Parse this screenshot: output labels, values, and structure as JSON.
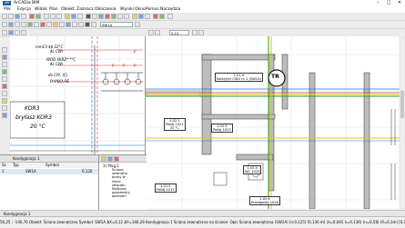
{
  "window": {
    "title": "ArCADia BIM",
    "app_icon": "AR",
    "minimize": "–",
    "maximize": "□",
    "close": "✕"
  },
  "menu": [
    "Plik",
    "Edycja",
    "Widok",
    "Plan",
    "Obiekt",
    "Zaznacz",
    "Oblicze­nia",
    "Wyniki",
    "Okno",
    "Pomoc",
    "Narzędzia",
    "Pomoc"
  ],
  "toolbar": {
    "layer_label": "SW1A",
    "zoom_value": "0,12"
  },
  "left_drawing": {
    "texts": [
      "mmCil $$ 22°C",
      "4L CWl",
      "WOD SKRZ* *°C",
      "4L CWl",
      "do Cfl/, (C)",
      "PIANKA PE",
      "KOR3",
      "bryłasz KOR3",
      "20 °C"
    ],
    "arrows": [
      "P",
      "P",
      "P",
      "P"
    ],
    "labels": [
      "KOR3",
      "KOR3"
    ]
  },
  "right_drawing": {
    "rooms": [
      {
        "num": "1.01.4",
        "name": "Kaloryfer CWU nr 1 (SW1A)",
        "area": "6,50"
      },
      {
        "num": "1.02.1",
        "name": "Pokój 1021",
        "area": "20 °C"
      },
      {
        "num": "1.02.3",
        "name": "Pokój 1023",
        "area": "20 °C"
      },
      {
        "num": "1.02.5",
        "name": "WC 1025",
        "area": "20 °C"
      },
      {
        "num": "1.02.6",
        "name": "Przedpokój 1026",
        "area": "20 °C"
      },
      {
        "num": "1.01.5",
        "name": "Pokój 1015",
        "area": ""
      }
    ],
    "tr_marker": "TR"
  },
  "panel_tabs": {
    "left": "Kondygnacja 1",
    "right": "Kondygnacja 1"
  },
  "bottom_left": {
    "header": [
      "Sz",
      "Typ",
      "Symbol"
    ],
    "rows": [
      [
        "1",
        "",
        "SW1A"
      ]
    ],
    "value": "0,120"
  },
  "table_panel": {
    "title": "1) Pług 1",
    "lines": [
      "Ściana",
      "zewnętrz",
      "piony w",
      "liście",
      "zespołu",
      "Wyboraj",
      "parametry",
      "obliczeń"
    ]
  },
  "status": "56,25 : -146,76   Obiekt: Ściana zewnętrzna   Symbol: SW1A   ΔX=0,12  ΔY=146,26   Kondygnacja 1   Ściana zewnętrzna na ścianie: Opis   Ściana zewnętrzna (SW1A) [n:0,125] [0,136 m] (λ=0,045 λ=0,136) (n=0,58) (δ=0,1m) [0,1m]"
}
